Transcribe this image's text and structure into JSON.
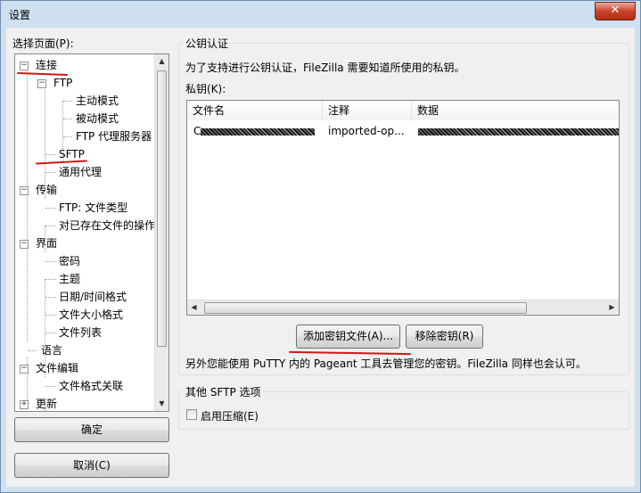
{
  "window": {
    "title": "设置",
    "close_symbol": "✕"
  },
  "left": {
    "label": "选择页面(P):",
    "tree": [
      {
        "label": "连接",
        "expander": "−"
      },
      {
        "label": "FTP",
        "expander": "−"
      },
      {
        "label": "主动模式"
      },
      {
        "label": "被动模式"
      },
      {
        "label": "FTP 代理服务器"
      },
      {
        "label": "SFTP"
      },
      {
        "label": "通用代理"
      },
      {
        "label": "传输",
        "expander": "−"
      },
      {
        "label": "FTP: 文件类型"
      },
      {
        "label": "对已存在文件的操作"
      },
      {
        "label": "界面",
        "expander": "−"
      },
      {
        "label": "密码"
      },
      {
        "label": "主题"
      },
      {
        "label": "日期/时间格式"
      },
      {
        "label": "文件大小格式"
      },
      {
        "label": "文件列表"
      },
      {
        "label": "语言"
      },
      {
        "label": "文件编辑",
        "expander": "−"
      },
      {
        "label": "文件格式关联"
      },
      {
        "label": "更新",
        "expander": "+"
      }
    ],
    "ok_button": "确定",
    "cancel_button": "取消(C)"
  },
  "pubkey": {
    "group_title": "公钥认证",
    "description": "为了支持进行公钥认证，FileZilla 需要知道所使用的私钥。",
    "keys_label": "私钥(K):",
    "columns": [
      "文件名",
      "注释",
      "数据"
    ],
    "rows": [
      {
        "filename_prefix": "C",
        "comment": "imported-op..."
      }
    ],
    "add_button": "添加密钥文件(A)...",
    "remove_button": "移除密钥(R)",
    "note": "另外您能使用 PuTTY 内的 Pageant 工具去管理您的密钥。FileZilla 同样也会认可。"
  },
  "other": {
    "group_title": "其他 SFTP 选项",
    "compression_label": "启用压缩(E)",
    "compression_checked": false
  },
  "colors": {
    "annotation_red": "#d01818",
    "window_frame": "#cfe0f0"
  }
}
